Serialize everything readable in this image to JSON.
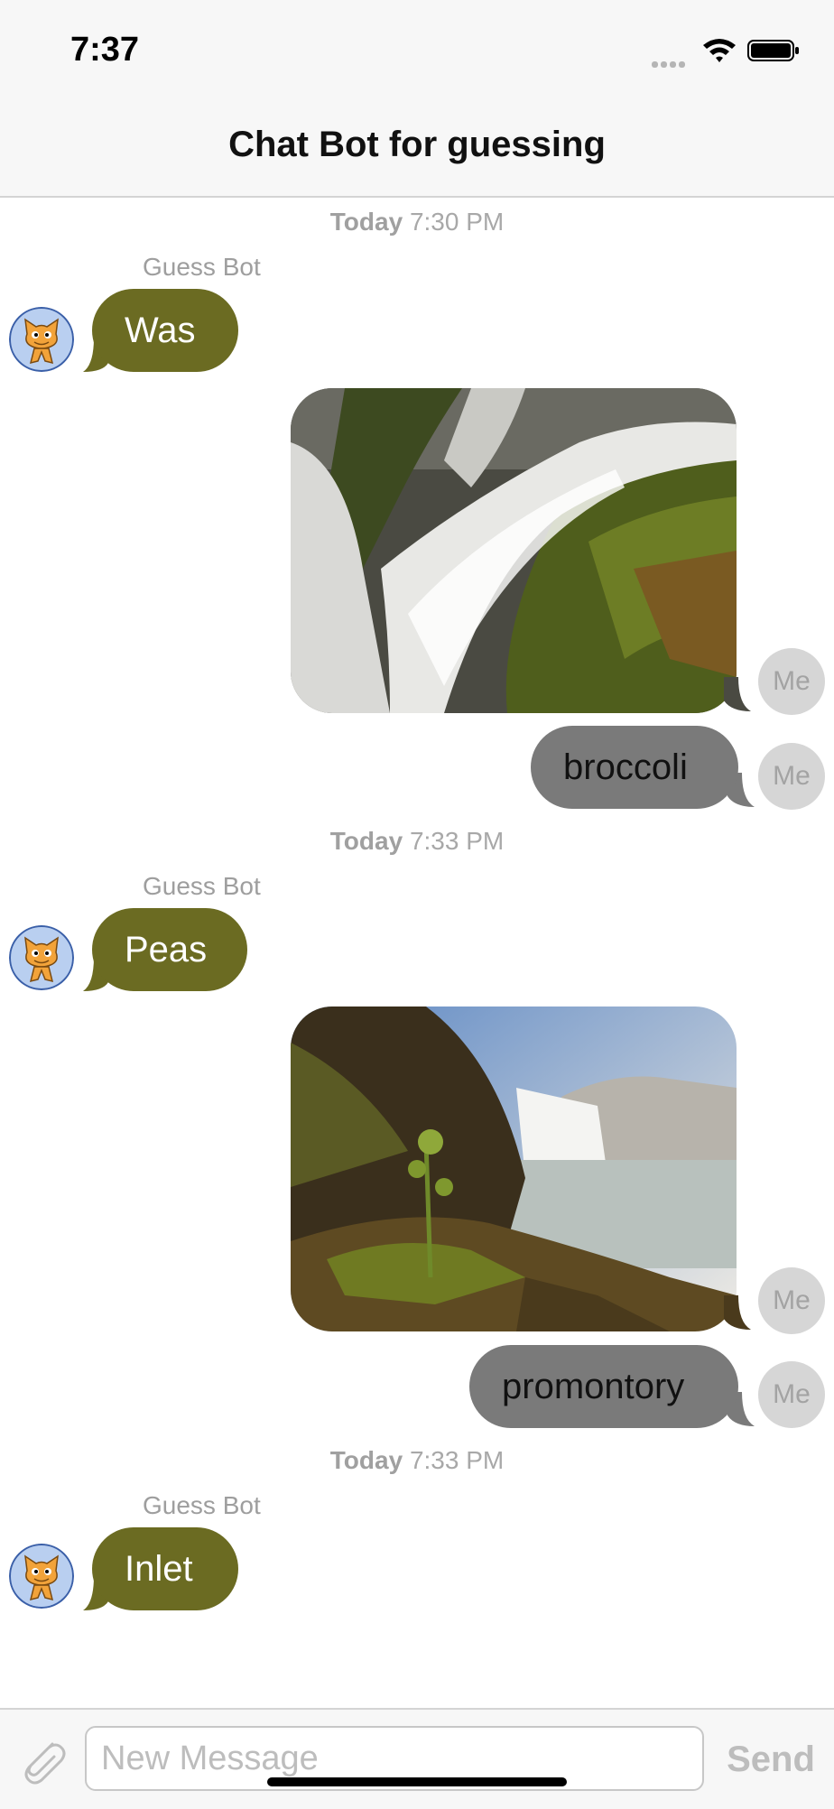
{
  "status_bar": {
    "time": "7:37"
  },
  "nav": {
    "title": "Chat Bot for guessing"
  },
  "messages": [
    {
      "timestamp_day": "Today",
      "timestamp_time": "7:30 PM",
      "sender": "Guess Bot",
      "bot_text": "Was"
    },
    {
      "user_text": "broccoli",
      "me_label": "Me"
    },
    {
      "timestamp_day": "Today",
      "timestamp_time": "7:33 PM",
      "sender": "Guess Bot",
      "bot_text": "Peas"
    },
    {
      "user_text": "promontory",
      "me_label": "Me"
    },
    {
      "timestamp_day": "Today",
      "timestamp_time": "7:33 PM",
      "sender": "Guess Bot",
      "bot_text": "Inlet"
    }
  ],
  "input_bar": {
    "placeholder": "New Message",
    "send_label": "Send"
  },
  "colors": {
    "bot_bubble": "#6b6b22",
    "user_bubble": "#7a7a7a",
    "me_avatar": "#d6d6d6"
  }
}
